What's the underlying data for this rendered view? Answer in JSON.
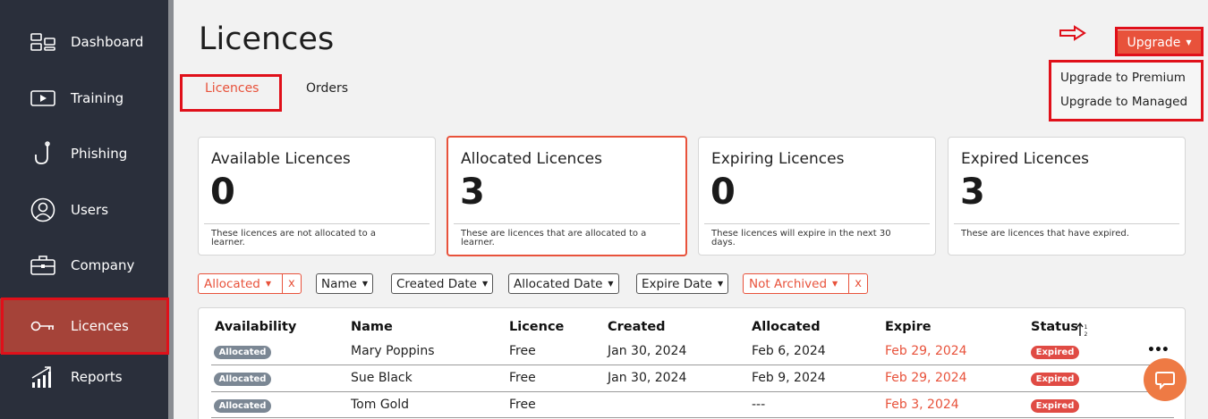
{
  "sidebar": {
    "items": [
      {
        "label": "Dashboard",
        "icon": "dashboard-icon"
      },
      {
        "label": "Training",
        "icon": "play-icon"
      },
      {
        "label": "Phishing",
        "icon": "hook-icon"
      },
      {
        "label": "Users",
        "icon": "user-icon"
      },
      {
        "label": "Company",
        "icon": "briefcase-icon"
      },
      {
        "label": "Licences",
        "icon": "key-icon",
        "active": true
      },
      {
        "label": "Reports",
        "icon": "chart-icon"
      }
    ]
  },
  "header": {
    "title": "Licences",
    "upgrade_label": "Upgrade",
    "upgrade_menu": [
      "Upgrade to Premium",
      "Upgrade to Managed"
    ]
  },
  "tabs": [
    "Licences",
    "Orders"
  ],
  "cards": [
    {
      "title": "Available Licences",
      "value": "0",
      "desc": "These licences are not allocated to a learner."
    },
    {
      "title": "Allocated Licences",
      "value": "3",
      "desc": "These are licences that are allocated to a learner."
    },
    {
      "title": "Expiring Licences",
      "value": "0",
      "desc": "These licences will expire in the next 30 days."
    },
    {
      "title": "Expired Licences",
      "value": "3",
      "desc": "These are licences that have expired."
    }
  ],
  "filters": {
    "allocated": "Allocated",
    "name": "Name",
    "created": "Created Date",
    "allocated_date": "Allocated Date",
    "expire": "Expire Date",
    "archived": "Not Archived",
    "clear": "x"
  },
  "table": {
    "headers": [
      "Availability",
      "Name",
      "Licence",
      "Created",
      "Allocated",
      "Expire",
      "Status"
    ],
    "rows": [
      {
        "availability": "Allocated",
        "name": "Mary Poppins",
        "licence": "Free",
        "created": "Jan 30, 2024",
        "allocated": "Feb 6, 2024",
        "expire": "Feb 29, 2024",
        "status": "Expired"
      },
      {
        "availability": "Allocated",
        "name": "Sue Black",
        "licence": "Free",
        "created": "Jan 30, 2024",
        "allocated": "Feb 9, 2024",
        "expire": "Feb 29, 2024",
        "status": "Expired"
      },
      {
        "availability": "Allocated",
        "name": "Tom Gold",
        "licence": "Free",
        "created": "",
        "allocated": "---",
        "expire": "Feb 3, 2024",
        "status": "Expired"
      }
    ],
    "more": "•••"
  },
  "colors": {
    "accent": "#e8523b",
    "sidebar": "#2a2f3b",
    "highlight": "#e0101a"
  }
}
